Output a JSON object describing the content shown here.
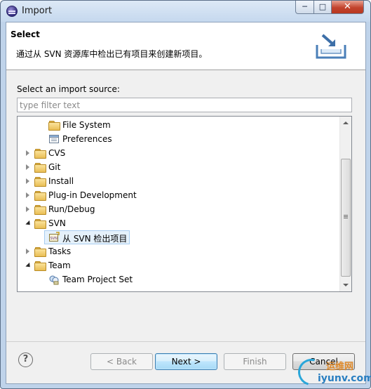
{
  "window": {
    "title": "Import",
    "minimize_glyph": "─",
    "maximize_glyph": "□",
    "close_glyph": "✕"
  },
  "header": {
    "title": "Select",
    "description": "通过从 SVN 资源库中检出已有项目来创建新项目。",
    "banner_icon": "import-wizard-icon"
  },
  "source": {
    "label": "Select an import source:",
    "filter_placeholder": "type filter text",
    "filter_value": ""
  },
  "tree": {
    "items": [
      {
        "label": "File System",
        "level": 1,
        "state": "leaf",
        "icon": "folder-icon"
      },
      {
        "label": "Preferences",
        "level": 1,
        "state": "leaf",
        "icon": "preferences-icon"
      },
      {
        "label": "CVS",
        "level": 0,
        "state": "collapsed",
        "icon": "folder-icon"
      },
      {
        "label": "Git",
        "level": 0,
        "state": "collapsed",
        "icon": "folder-icon"
      },
      {
        "label": "Install",
        "level": 0,
        "state": "collapsed",
        "icon": "folder-icon"
      },
      {
        "label": "Plug-in Development",
        "level": 0,
        "state": "collapsed",
        "icon": "folder-icon"
      },
      {
        "label": "Run/Debug",
        "level": 0,
        "state": "collapsed",
        "icon": "folder-icon"
      },
      {
        "label": "SVN",
        "level": 0,
        "state": "expanded",
        "icon": "open-folder-icon"
      },
      {
        "label": "从 SVN 检出项目",
        "level": 1,
        "state": "leaf",
        "icon": "svn-checkout-icon",
        "selected": true
      },
      {
        "label": "Tasks",
        "level": 0,
        "state": "collapsed",
        "icon": "folder-icon"
      },
      {
        "label": "Team",
        "level": 0,
        "state": "expanded",
        "icon": "open-folder-icon"
      },
      {
        "label": "Team Project Set",
        "level": 1,
        "state": "leaf",
        "icon": "team-project-set-icon"
      }
    ]
  },
  "buttons": {
    "help": "?",
    "back": "< Back",
    "next": "Next >",
    "finish": "Finish",
    "cancel": "Cancel"
  },
  "watermark": {
    "cn": "运维网",
    "en": "iyunv.com"
  },
  "colors": {
    "selection_bg": "#e5f1fb",
    "default_button_border": "#3c7fb1",
    "close_button": "#c2432d"
  }
}
